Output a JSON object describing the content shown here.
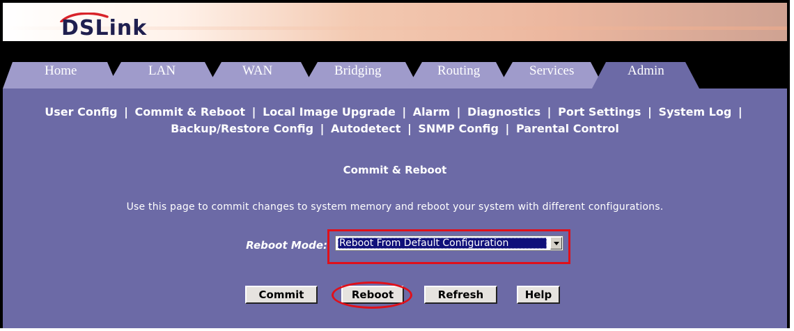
{
  "brand": {
    "logo_text": "DSLink"
  },
  "tabs": [
    {
      "label": "Home"
    },
    {
      "label": "LAN"
    },
    {
      "label": "WAN"
    },
    {
      "label": "Bridging"
    },
    {
      "label": "Routing"
    },
    {
      "label": "Services"
    },
    {
      "label": "Admin",
      "active": true
    }
  ],
  "subnav": {
    "items": [
      "User Config",
      "Commit & Reboot",
      "Local Image Upgrade",
      "Alarm",
      "Diagnostics",
      "Port Settings",
      "System Log",
      "Backup/Restore Config",
      "Autodetect",
      "SNMP Config",
      "Parental Control"
    ],
    "separator": "|"
  },
  "page": {
    "title": "Commit & Reboot",
    "description": "Use this page to commit changes to system memory and reboot your system with different configurations."
  },
  "form": {
    "reboot_mode_label": "Reboot Mode:",
    "reboot_mode_value": "Reboot From Default Configuration"
  },
  "buttons": {
    "commit": "Commit",
    "reboot": "Reboot",
    "refresh": "Refresh",
    "help": "Help"
  },
  "colors": {
    "panel": "#6c6aa6",
    "tab_inactive": "#9f9bcb",
    "tab_active": "#6c6aa6",
    "highlight": "#e0101a"
  }
}
